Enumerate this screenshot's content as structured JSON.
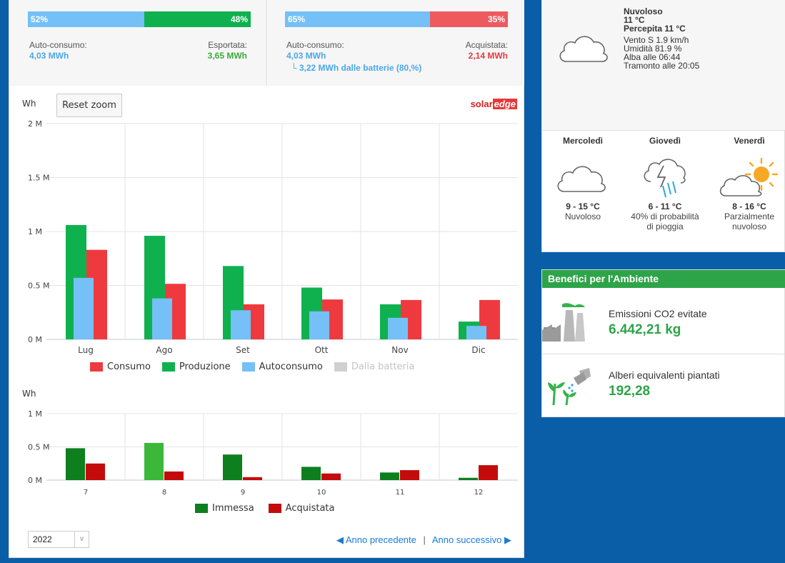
{
  "summary_left": {
    "bar_left_pct": "52%",
    "bar_right_pct": "48%",
    "label_left": "Auto-consumo:",
    "value_left": "4,03 MWh",
    "label_right": "Esportata:",
    "value_right": "3,65 MWh",
    "share_left": 0.52
  },
  "summary_right": {
    "bar_left_pct": "65%",
    "bar_right_pct": "35%",
    "label_left": "Auto-consumo:",
    "value_left": "4,03 MWh",
    "sub_value": "└ 3,22 MWh dalle batterie (80,%)",
    "label_right": "Acquistata:",
    "value_right": "2,14 MWh",
    "share_left": 0.65
  },
  "reset_zoom_label": "Reset zoom",
  "logo": {
    "part1": "solar",
    "part2": "edge"
  },
  "colors": {
    "self_consumption": "#74c0f7",
    "production": "#0fb14f",
    "consumption": "#ee3a3f",
    "from_battery": "#d0d0d0",
    "injected": "#0e7f1f",
    "injected_highlight": "#3bb83a",
    "purchased": "#c40b0b",
    "weather_green": "#2ea449"
  },
  "chart_data": [
    {
      "type": "bar",
      "ylabel": "Wh",
      "yticks": [
        "0 M",
        "0.5 M",
        "1 M",
        "1.5 M",
        "2 M"
      ],
      "ylim": [
        0,
        2000000
      ],
      "categories": [
        "Lug",
        "Ago",
        "Set",
        "Ott",
        "Nov",
        "Dic"
      ],
      "series": [
        {
          "name": "Produzione",
          "values": [
            1060000,
            960000,
            680000,
            480000,
            325000,
            165000
          ]
        },
        {
          "name": "Consumo",
          "values": [
            830000,
            515000,
            325000,
            370000,
            365000,
            365000
          ]
        },
        {
          "name": "Autoconsumo",
          "values": [
            570000,
            380000,
            270000,
            260000,
            200000,
            125000
          ]
        },
        {
          "name": "Dalla batteria",
          "values": [
            0,
            0,
            0,
            0,
            0,
            0
          ]
        }
      ],
      "legend": [
        "Consumo",
        "Produzione",
        "Autoconsumo",
        "Dalla batteria"
      ],
      "grid": true
    },
    {
      "type": "bar",
      "ylabel": "Wh",
      "yticks": [
        "0 M",
        "0.5 M",
        "1 M"
      ],
      "ylim": [
        0,
        1000000
      ],
      "categories": [
        "7",
        "8",
        "9",
        "10",
        "11",
        "12"
      ],
      "series": [
        {
          "name": "Immessa",
          "values": [
            480000,
            560000,
            385000,
            200000,
            115000,
            35000
          ]
        },
        {
          "name": "Acquistata",
          "values": [
            250000,
            130000,
            45000,
            100000,
            150000,
            225000
          ]
        }
      ],
      "legend": [
        "Immessa",
        "Acquistata"
      ],
      "grid": true
    }
  ],
  "footer": {
    "year": "2022",
    "prev": "Anno precedente",
    "separator": "|",
    "next": "Anno successivo"
  },
  "weather": {
    "current": {
      "condition": "Nuvoloso",
      "temp": "11 °C",
      "feels": "Percepita 11 °C",
      "wind": "Vento S 1.9 km/h",
      "humidity": "Umidità 81.9 %",
      "sunrise": "Alba alle 06:44",
      "sunset": "Tramonto alle 20:05"
    },
    "forecast": [
      {
        "day": "Mercoledì",
        "temp": "9 - 15 °C",
        "desc1": "Nuvoloso",
        "desc2": "",
        "icon": "cloud-icon"
      },
      {
        "day": "Giovedì",
        "temp": "6 - 11 °C",
        "desc1": "40% di probabilità",
        "desc2": "di pioggia",
        "icon": "thunder-rain-icon"
      },
      {
        "day": "Venerdì",
        "temp": "8 - 16 °C",
        "desc1": "Parzialmente",
        "desc2": "nuvoloso",
        "icon": "partly-sunny-icon"
      }
    ]
  },
  "environment": {
    "title": "Benefici per l'Ambiente",
    "co2_label": "Emissioni CO2 evitate",
    "co2_value": "6.442,21 kg",
    "trees_label": "Alberi equivalenti piantati",
    "trees_value": "192,28"
  }
}
